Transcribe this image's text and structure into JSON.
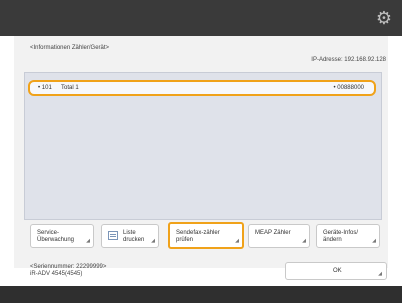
{
  "header": {
    "gear_icon": "gear-icon"
  },
  "page": {
    "title": "<Informationen Zähler/Gerät>",
    "ip_address": "IP-Adresse: 192.168.92.128"
  },
  "counter_list": {
    "items": [
      {
        "id": "101",
        "name": "Total 1",
        "value": "00888000",
        "selected": true
      }
    ]
  },
  "buttons": [
    {
      "label": "Service-Überwachung"
    },
    {
      "label": "Liste drucken",
      "icon": "list-icon"
    },
    {
      "label": "Sendefax-zähler prüfen",
      "selected": true
    },
    {
      "label": "MEAP Zähler"
    },
    {
      "label": "Geräte-Infos/ ändern"
    }
  ],
  "footer": {
    "serial": "<Seriennummer: 22299999>",
    "model": "iR-ADV 4545(4545)",
    "ok_label": "OK"
  }
}
